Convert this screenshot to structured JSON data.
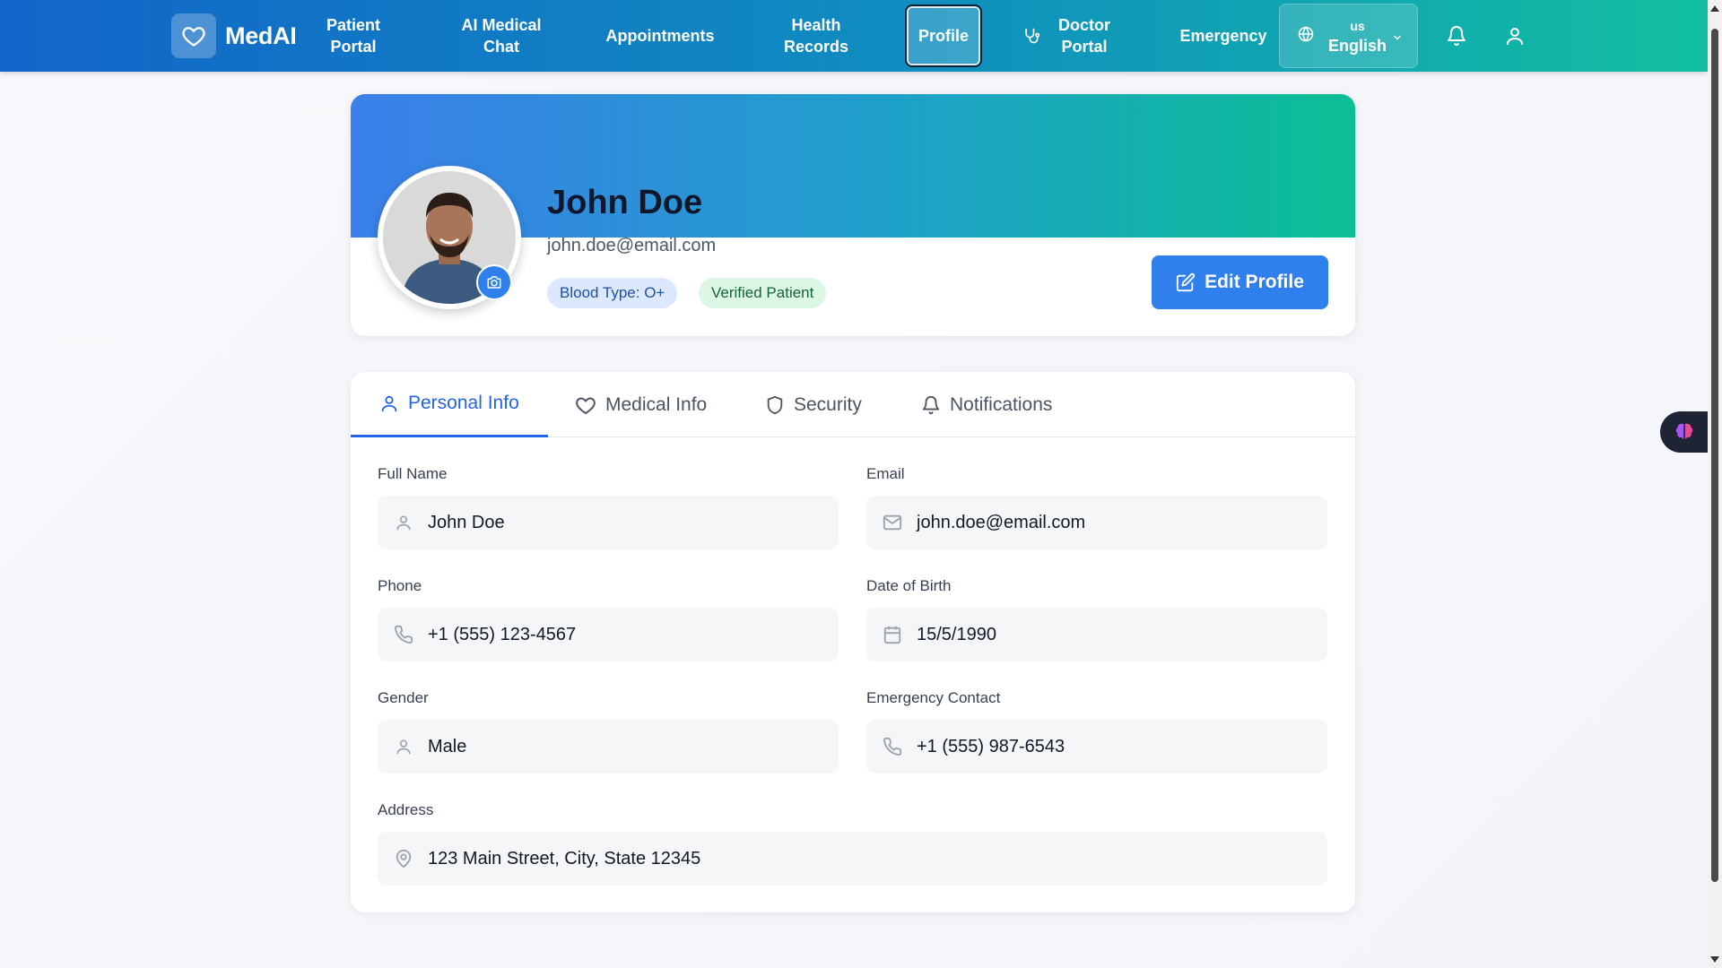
{
  "header": {
    "brand": "MedAI",
    "nav": [
      {
        "label": "Patient\nPortal"
      },
      {
        "label": "AI Medical\nChat"
      },
      {
        "label": "Appointments"
      },
      {
        "label": "Health\nRecords"
      },
      {
        "label": "Profile",
        "active": true
      },
      {
        "label": "Doctor\nPortal"
      },
      {
        "label": "Emergency"
      }
    ],
    "language": {
      "code": "us",
      "name": "English"
    }
  },
  "profile": {
    "name": "John Doe",
    "email": "john.doe@email.com",
    "badges": {
      "blood": "Blood Type: O+",
      "verified": "Verified Patient"
    },
    "edit_label": "Edit Profile"
  },
  "tabs": [
    {
      "label": "Personal Info",
      "icon": "user-icon",
      "active": true
    },
    {
      "label": "Medical Info",
      "icon": "heart-icon"
    },
    {
      "label": "Security",
      "icon": "shield-icon"
    },
    {
      "label": "Notifications",
      "icon": "bell-icon"
    }
  ],
  "fields": {
    "full_name": {
      "label": "Full Name",
      "value": "John Doe"
    },
    "email": {
      "label": "Email",
      "value": "john.doe@email.com"
    },
    "phone": {
      "label": "Phone",
      "value": "+1 (555) 123-4567"
    },
    "dob": {
      "label": "Date of Birth",
      "value": "15/5/1990"
    },
    "gender": {
      "label": "Gender",
      "value": "Male"
    },
    "emergency": {
      "label": "Emergency Contact",
      "value": "+1 (555) 987-6543"
    },
    "address": {
      "label": "Address",
      "value": "123 Main Street, City, State 12345"
    }
  },
  "colors": {
    "accent": "#2f80ed",
    "active_tab": "#2563eb",
    "header_start": "#1265c9",
    "header_end": "#12bfa0",
    "verified_bg": "#dcf7e6",
    "blood_bg": "#dbe8fd"
  }
}
